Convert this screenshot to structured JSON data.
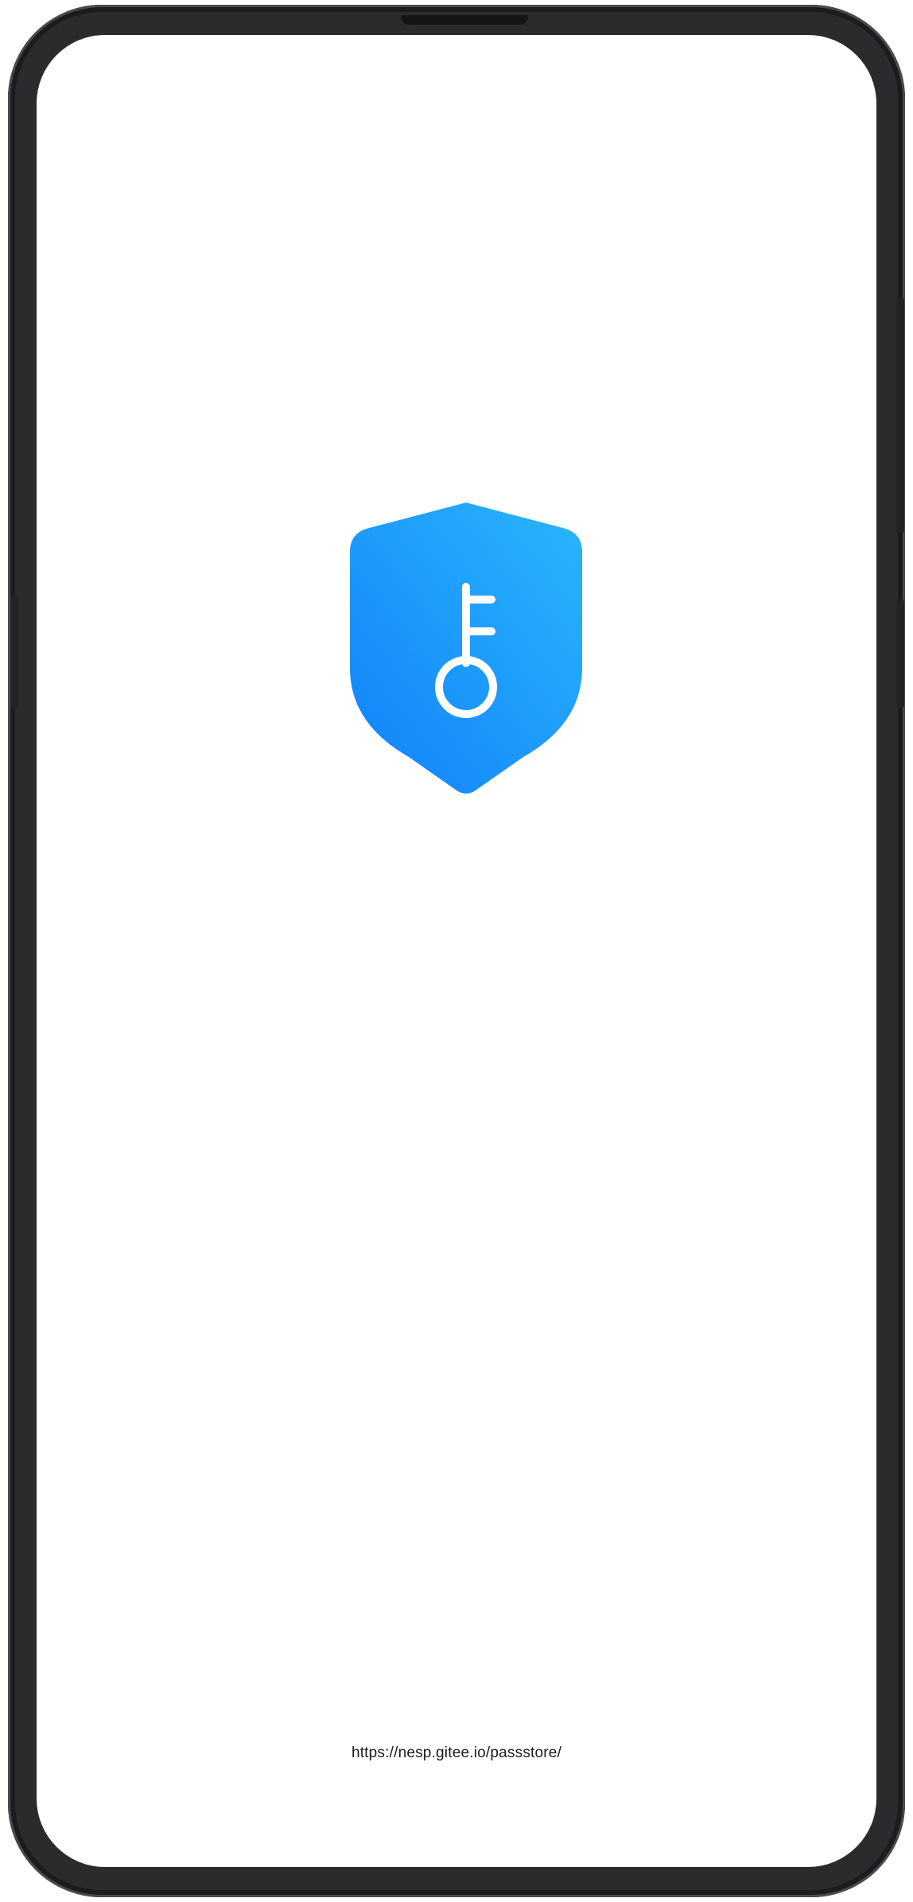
{
  "splash": {
    "logo_icon": "shield-key-icon",
    "footer_url": "https://nesp.gitee.io/passstore/"
  },
  "colors": {
    "logo_gradient_start": "#29B6FB",
    "logo_gradient_end": "#1281FB",
    "background": "#FFFFFF",
    "frame": "#2B2B2E"
  }
}
